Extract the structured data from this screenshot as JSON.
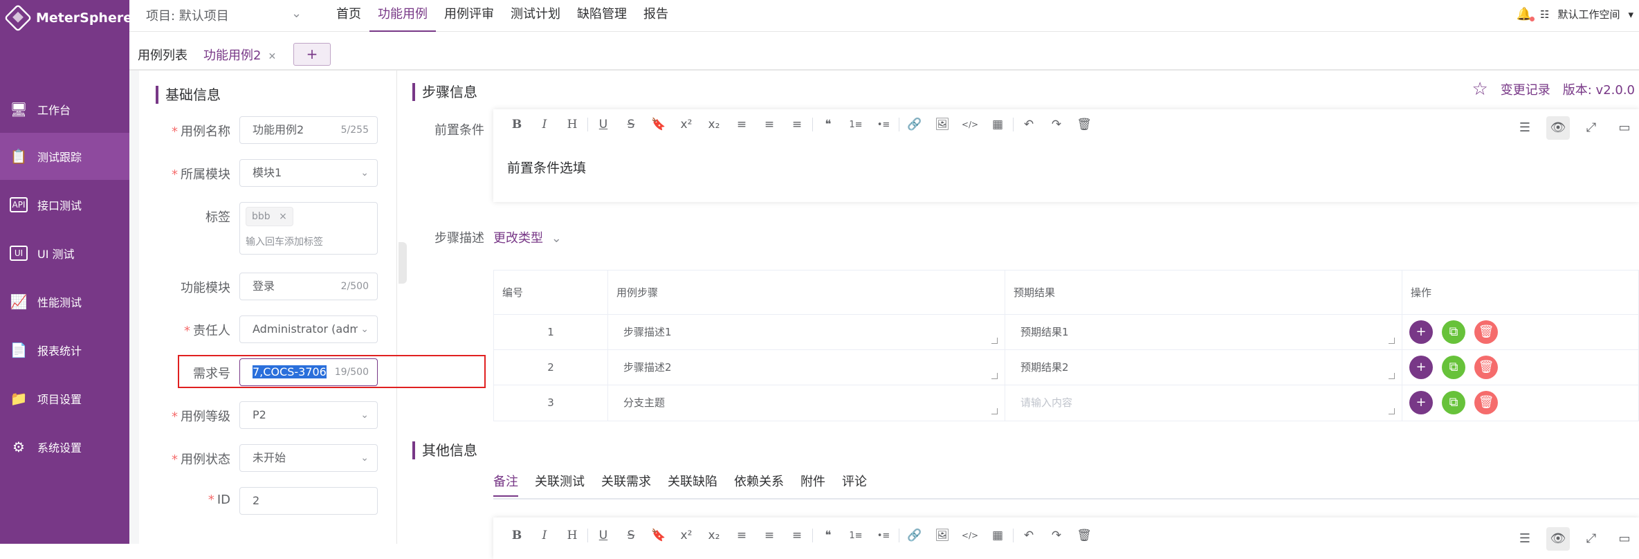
{
  "app": {
    "name": "MeterSphere"
  },
  "sidebar": {
    "items": [
      {
        "label": "工作台",
        "icon": "monitor-icon"
      },
      {
        "label": "测试跟踪",
        "icon": "clipboard-icon"
      },
      {
        "label": "接口测试",
        "icon": "api-icon"
      },
      {
        "label": "UI 测试",
        "icon": "ui-icon"
      },
      {
        "label": "性能测试",
        "icon": "performance-icon"
      },
      {
        "label": "报表统计",
        "icon": "report-icon"
      },
      {
        "label": "项目设置",
        "icon": "folder-settings-icon"
      },
      {
        "label": "系统设置",
        "icon": "gear-icon"
      }
    ],
    "active_index": 1
  },
  "header": {
    "project": "项目: 默认项目",
    "nav": [
      "首页",
      "功能用例",
      "用例评审",
      "测试计划",
      "缺陷管理",
      "报告"
    ],
    "workspace": "默认工作空间"
  },
  "tabs": {
    "list": "用例列表",
    "current": "功能用例2",
    "add": "+"
  },
  "basic": {
    "title": "基础信息",
    "name_label": "用例名称",
    "name_value": "功能用例2",
    "name_count": "5/255",
    "module_label": "所属模块",
    "module_value": "模块1",
    "tag_label": "标签",
    "tag_value": "bbb",
    "tag_close": "×",
    "tag_placeholder": "输入回车添加标签",
    "func_label": "功能模块",
    "func_value": "登录",
    "func_count": "2/500",
    "owner_label": "责任人",
    "owner_value": "Administrator (admi",
    "req_label": "需求号",
    "req_value": "7,COCS-3706",
    "req_count": "19/500",
    "level_label": "用例等级",
    "level_value": "P2",
    "status_label": "用例状态",
    "status_value": "未开始",
    "id_label": "ID",
    "id_value": "2"
  },
  "steps": {
    "title": "步骤信息",
    "change_log": "变更记录",
    "version": "版本: v2.0.0",
    "precondition_label": "前置条件",
    "precondition_text": "前置条件选填",
    "desc_label": "步骤描述",
    "change_type": "更改类型",
    "columns": [
      "编号",
      "用例步骤",
      "预期结果",
      "操作"
    ],
    "rows": [
      {
        "num": "1",
        "step": "步骤描述1",
        "expected": "预期结果1"
      },
      {
        "num": "2",
        "step": "步骤描述2",
        "expected": "预期结果2"
      },
      {
        "num": "3",
        "step": "分支主题",
        "expected_placeholder": "请输入内容"
      }
    ]
  },
  "other": {
    "title": "其他信息",
    "tabs": [
      "备注",
      "关联测试",
      "关联需求",
      "关联缺陷",
      "依赖关系",
      "附件",
      "评论"
    ]
  },
  "toolbar": {
    "buttons": [
      "B",
      "I",
      "H",
      "U",
      "S",
      "🔖",
      "x²",
      "x₂",
      "≡",
      "≡",
      "≡",
      "❝",
      "1≡",
      "•≡",
      "🔗",
      "🖼",
      "</>",
      "▦",
      "↶",
      "↷",
      "🗑"
    ]
  },
  "colors": {
    "primary": "#783887",
    "danger": "#f56c6c",
    "success": "#67c23a"
  }
}
